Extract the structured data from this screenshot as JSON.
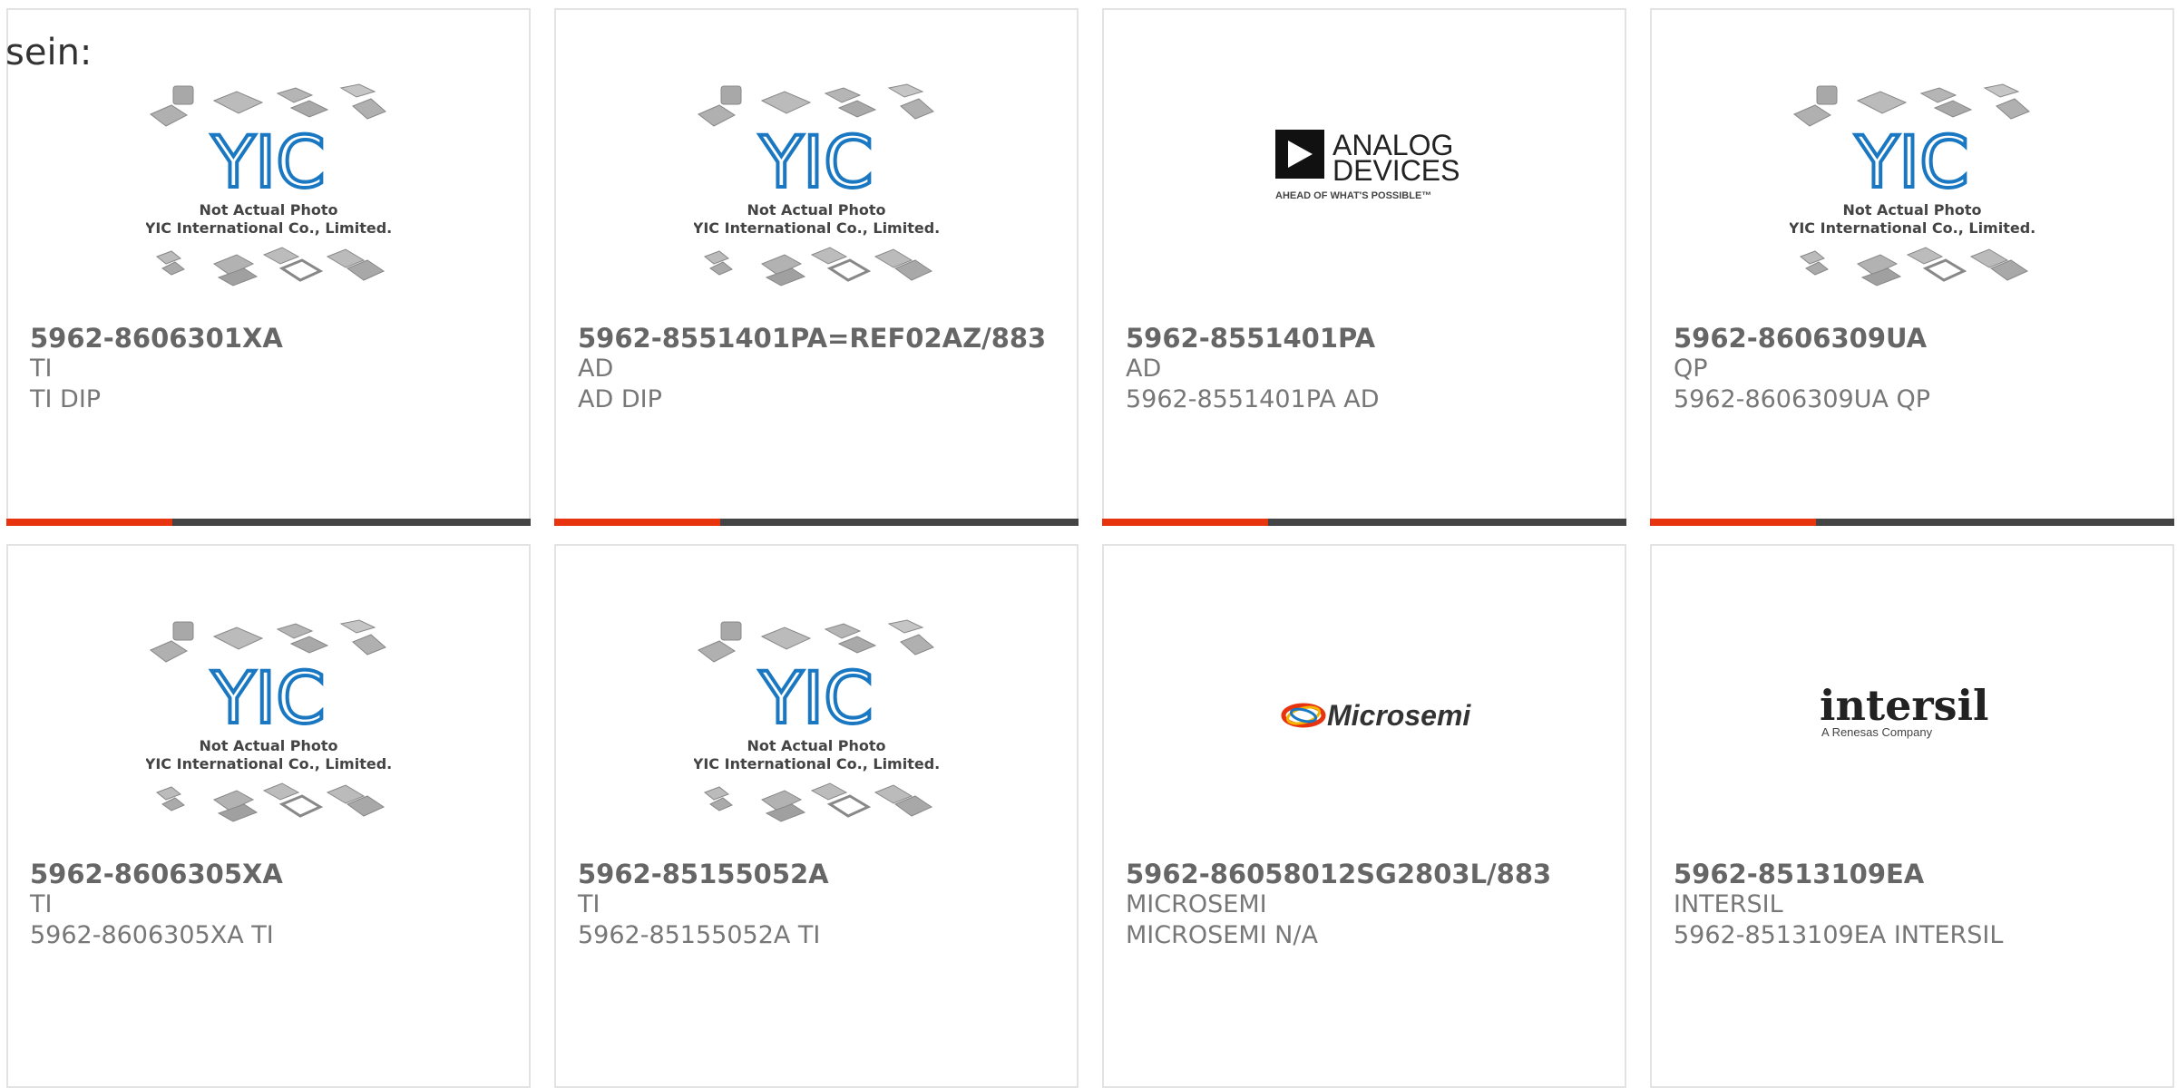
{
  "heading": "sein:",
  "placeholder": {
    "line1": "Not Actual Photo",
    "line2": "YIC International Co., Limited.",
    "logo_text": "YIC"
  },
  "brands": {
    "analog": {
      "line1": "ANALOG",
      "line2": "DEVICES",
      "tagline": "AHEAD OF WHAT'S POSSIBLE™"
    },
    "microsemi": {
      "name": "Microsemi"
    },
    "intersil": {
      "name": "intersil",
      "tagline": "A Renesas Company"
    }
  },
  "products": [
    {
      "part": "5962-8606301XA",
      "brand": "TI",
      "desc": "TI DIP",
      "image": "placeholder"
    },
    {
      "part": "5962-8551401PA=REF02AZ/883",
      "brand": "AD",
      "desc": "AD DIP",
      "image": "placeholder"
    },
    {
      "part": "5962-8551401PA",
      "brand": "AD",
      "desc": "5962-8551401PA AD",
      "image": "analog-devices-logo"
    },
    {
      "part": "5962-8606309UA",
      "brand": "QP",
      "desc": "5962-8606309UA QP",
      "image": "placeholder"
    },
    {
      "part": "5962-8606305XA",
      "brand": "TI",
      "desc": "5962-8606305XA TI",
      "image": "placeholder"
    },
    {
      "part": "5962-85155052A",
      "brand": "TI",
      "desc": "5962-85155052A TI",
      "image": "placeholder"
    },
    {
      "part": "5962-86058012SG2803L/883",
      "brand": "MICROSEMI",
      "desc": "MICROSEMI N/A",
      "image": "microsemi-logo"
    },
    {
      "part": "5962-8513109EA",
      "brand": "INTERSIL",
      "desc": "5962-8513109EA INTERSIL",
      "image": "intersil-logo"
    }
  ],
  "colors": {
    "accent": "#e8330f",
    "bar": "#444444",
    "border": "#e3e3e3",
    "yic_blue": "#1a78c2"
  }
}
